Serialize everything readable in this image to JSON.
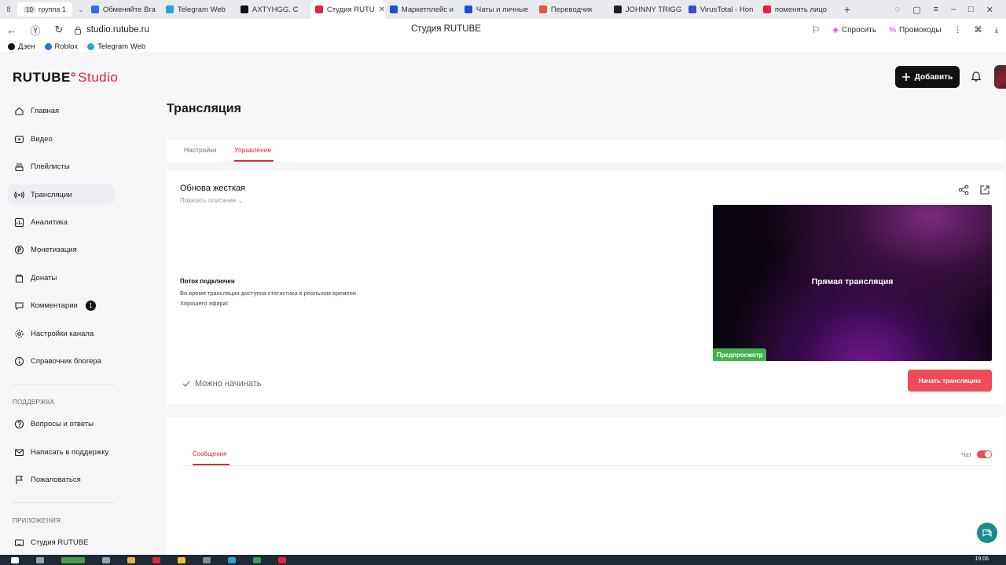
{
  "browser": {
    "tab_count": "8",
    "group": {
      "number": "10",
      "label": "группа 1"
    },
    "tabs": [
      {
        "title": "Обменяйте Bra",
        "icon": "tab-favicon",
        "color": "#2f6fe4"
      },
      {
        "title": "Telegram Web",
        "icon": "telegram-icon",
        "color": "#2aa3df"
      },
      {
        "title": "AXTYHGG. C",
        "icon": "rutube-icon",
        "color": "#111111"
      },
      {
        "title": "Студия RUTU",
        "icon": "rutube-studio-icon",
        "color": "#e3233f",
        "active": true
      },
      {
        "title": "Маркетплейс и",
        "icon": "tab-favicon",
        "color": "#1c4fd6"
      },
      {
        "title": "Чаты и личные",
        "icon": "tab-favicon",
        "color": "#1c4fd6"
      },
      {
        "title": "Переводчик",
        "icon": "translator-icon",
        "color": "#e2573d"
      },
      {
        "title": "JOHNNY TRIGG",
        "icon": "tab-favicon",
        "color": "#222222"
      },
      {
        "title": "VirusTotal - Hon",
        "icon": "virustotal-icon",
        "color": "#3b4bd6"
      },
      {
        "title": "поменять лицо",
        "icon": "yandex-icon",
        "color": "#e3233f"
      }
    ],
    "url": "studio.rutube.ru",
    "page_title": "Студия RUTUBE",
    "ask_label": "Спросить",
    "promo_label": "Промокоды",
    "bookmarks": [
      {
        "label": "Дзен",
        "color": "#111111"
      },
      {
        "label": "Roblox",
        "color": "#2f6fe4"
      },
      {
        "label": "Telegram Web",
        "color": "#2aa3df"
      }
    ]
  },
  "app": {
    "logo_main": "RUTUBE",
    "logo_dot": "°",
    "logo_studio": "Studio",
    "add_label": "Добавить",
    "nav": [
      {
        "label": "Главная",
        "icon": "home-icon"
      },
      {
        "label": "Видео",
        "icon": "video-icon"
      },
      {
        "label": "Плейлисты",
        "icon": "playlist-icon"
      },
      {
        "label": "Трансляции",
        "icon": "broadcast-icon",
        "active": true
      },
      {
        "label": "Аналитика",
        "icon": "analytics-icon"
      },
      {
        "label": "Монетизация",
        "icon": "ruble-icon"
      },
      {
        "label": "Донаты",
        "icon": "donate-icon"
      },
      {
        "label": "Комментарии",
        "icon": "comment-icon",
        "badge": "1"
      },
      {
        "label": "Настройки канала",
        "icon": "settings-icon"
      },
      {
        "label": "Справочник блогера",
        "icon": "info-icon"
      }
    ],
    "support_heading": "ПОДДЕРЖКА",
    "support": [
      {
        "label": "Вопросы и ответы",
        "icon": "help-icon"
      },
      {
        "label": "Написать в поддержку",
        "icon": "mail-icon"
      },
      {
        "label": "Пожаловаться",
        "icon": "flag-icon"
      }
    ],
    "apps_heading": "ПРИЛОЖЕНИЯ",
    "apps": [
      {
        "label": "Студия RUTUBE",
        "icon": "keyboard-icon"
      }
    ],
    "page_title": "Трансляция",
    "page_tabs": [
      {
        "label": "Настройки"
      },
      {
        "label": "Управление",
        "active": true
      }
    ],
    "stream": {
      "title": "Обнова жесткая",
      "show_description": "Показать описание",
      "status_title": "Поток подключен",
      "status_line1": "Во время трансляции доступна статистика в реальном времени.",
      "status_line2": "Хорошего эфира!",
      "preview_label": "Прямая трансляция",
      "preview_badge": "Предпросмотр",
      "ready_label": "Можно начинать",
      "start_label": "Начать трансляцию"
    },
    "chat": {
      "messages_tab": "Сообщения",
      "chat_label": "Чат",
      "chat_enabled": true
    },
    "accent_color": "#e3233f"
  },
  "taskbar": {
    "clock": "19:06"
  }
}
